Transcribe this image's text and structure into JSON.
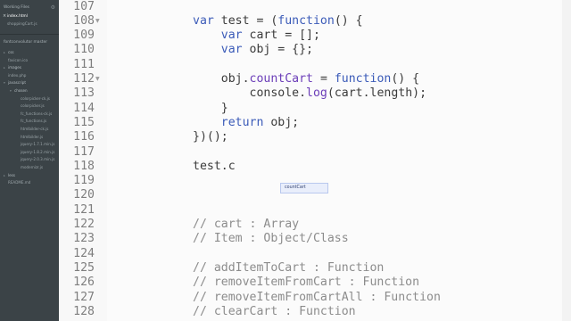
{
  "sidebar": {
    "working_files_label": "Working Files",
    "working_files": [
      {
        "name": "index.html",
        "active": true
      },
      {
        "name": "shoppingCart.js",
        "active": false
      }
    ],
    "project_name": "fontconvolutor master",
    "tree": [
      {
        "label": "css",
        "type": "folder",
        "depth": 0,
        "open": false
      },
      {
        "label": "favicon.ico",
        "type": "file",
        "depth": 0
      },
      {
        "label": "images",
        "type": "folder",
        "depth": 0,
        "open": false
      },
      {
        "label": "index.php",
        "type": "file",
        "depth": 0
      },
      {
        "label": "javascript",
        "type": "folder",
        "depth": 0,
        "open": true
      },
      {
        "label": "chosen",
        "type": "folder",
        "depth": 1,
        "open": true
      },
      {
        "label": "colorpicker-ck.js",
        "type": "file",
        "depth": 2
      },
      {
        "label": "colorpicker.js",
        "type": "file",
        "depth": 2
      },
      {
        "label": "fc_functions-ck.js",
        "type": "file",
        "depth": 2
      },
      {
        "label": "fc_functions.js",
        "type": "file",
        "depth": 2
      },
      {
        "label": "htmlbilder-ck.js",
        "type": "file",
        "depth": 2
      },
      {
        "label": "htmlbilder.js",
        "type": "file",
        "depth": 2
      },
      {
        "label": "jquery-1.7.1.min.js",
        "type": "file",
        "depth": 2
      },
      {
        "label": "jquery-1.8.2.min.js",
        "type": "file",
        "depth": 2
      },
      {
        "label": "jquery-2.0.3.min.js",
        "type": "file",
        "depth": 2
      },
      {
        "label": "modernizr.js",
        "type": "file",
        "depth": 2
      },
      {
        "label": "less",
        "type": "folder",
        "depth": 0,
        "open": false
      },
      {
        "label": "README.md",
        "type": "file",
        "depth": 0
      }
    ]
  },
  "editor": {
    "autocomplete_hint": "countCart",
    "lines": [
      {
        "num": "107",
        "segments": []
      },
      {
        "num": "108",
        "fold": true,
        "segments": [
          {
            "t": "kw",
            "v": "var"
          },
          {
            "t": "p",
            "v": " test = ("
          },
          {
            "t": "kw",
            "v": "function"
          },
          {
            "t": "p",
            "v": "() {"
          }
        ]
      },
      {
        "num": "109",
        "segments": [
          {
            "t": "p",
            "v": "    "
          },
          {
            "t": "kw",
            "v": "var"
          },
          {
            "t": "p",
            "v": " cart = [];"
          }
        ]
      },
      {
        "num": "110",
        "segments": [
          {
            "t": "p",
            "v": "    "
          },
          {
            "t": "kw",
            "v": "var"
          },
          {
            "t": "p",
            "v": " obj = {};"
          }
        ]
      },
      {
        "num": "111",
        "segments": []
      },
      {
        "num": "112",
        "fold": true,
        "segments": [
          {
            "t": "p",
            "v": "    obj."
          },
          {
            "t": "fn",
            "v": "countCart"
          },
          {
            "t": "p",
            "v": " = "
          },
          {
            "t": "kw",
            "v": "function"
          },
          {
            "t": "p",
            "v": "() {"
          }
        ]
      },
      {
        "num": "113",
        "segments": [
          {
            "t": "p",
            "v": "        console."
          },
          {
            "t": "fn",
            "v": "log"
          },
          {
            "t": "p",
            "v": "(cart.length);"
          }
        ]
      },
      {
        "num": "114",
        "segments": [
          {
            "t": "p",
            "v": "    }"
          }
        ]
      },
      {
        "num": "115",
        "segments": [
          {
            "t": "p",
            "v": "    "
          },
          {
            "t": "kw",
            "v": "return"
          },
          {
            "t": "p",
            "v": " obj;"
          }
        ]
      },
      {
        "num": "116",
        "segments": [
          {
            "t": "p",
            "v": "})();"
          }
        ]
      },
      {
        "num": "117",
        "segments": []
      },
      {
        "num": "118",
        "segments": [
          {
            "t": "p",
            "v": "test.c"
          }
        ]
      },
      {
        "num": "119",
        "segments": []
      },
      {
        "num": "120",
        "segments": []
      },
      {
        "num": "121",
        "segments": []
      },
      {
        "num": "122",
        "segments": [
          {
            "t": "cm",
            "v": "// cart : Array"
          }
        ]
      },
      {
        "num": "123",
        "segments": [
          {
            "t": "cm",
            "v": "// Item : Object/Class"
          }
        ]
      },
      {
        "num": "124",
        "segments": []
      },
      {
        "num": "125",
        "segments": [
          {
            "t": "cm",
            "v": "// addItemToCart : Function"
          }
        ]
      },
      {
        "num": "126",
        "segments": [
          {
            "t": "cm",
            "v": "// removeItemFromCart : Function"
          }
        ]
      },
      {
        "num": "127",
        "segments": [
          {
            "t": "cm",
            "v": "// removeItemFromCartAll : Function"
          }
        ]
      },
      {
        "num": "128",
        "segments": [
          {
            "t": "cm",
            "v": "// clearCart : Function"
          }
        ]
      }
    ]
  },
  "icons": {
    "settings": "gear-icon",
    "close": "close-icon",
    "fold": "fold-arrow-icon",
    "folder_open": "triangle-down-icon",
    "folder_closed": "triangle-right-icon"
  },
  "colors": {
    "sidebar_bg": "#3b4347",
    "keyword": "#3b5bb8",
    "function": "#6b3db8",
    "comment": "#8c8c8c"
  }
}
